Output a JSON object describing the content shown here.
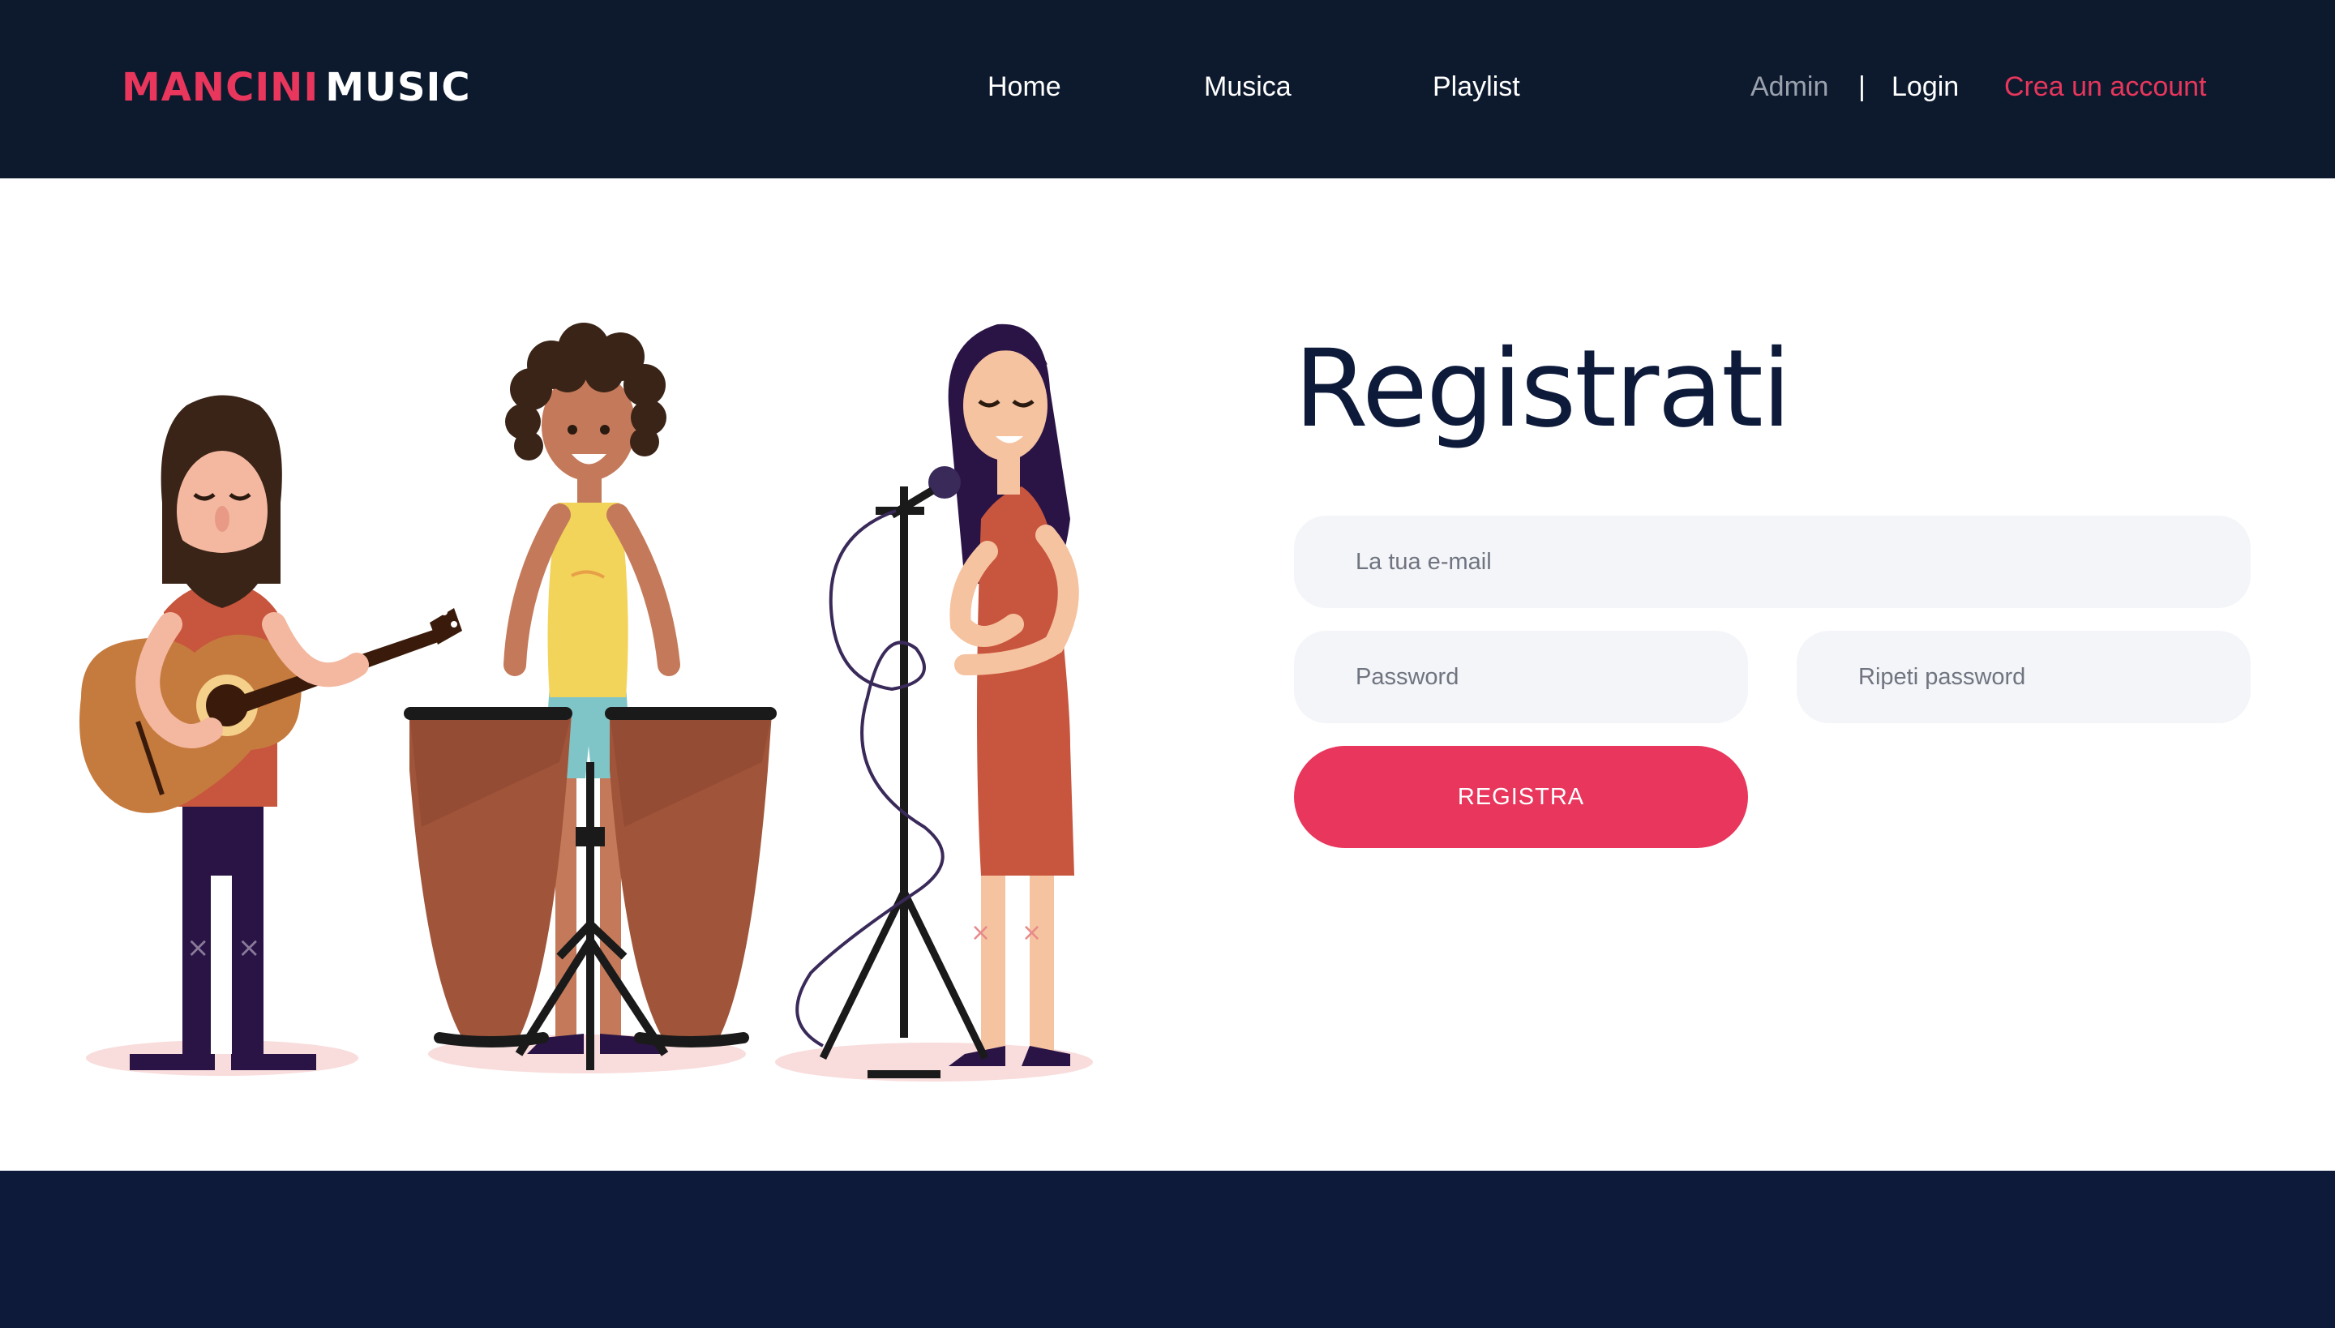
{
  "header": {
    "brand_part1": "MANCINI",
    "brand_part2": "MUSIC",
    "nav": {
      "home": "Home",
      "musica": "Musica",
      "playlist": "Playlist"
    },
    "account": {
      "admin": "Admin",
      "separator": "|",
      "login": "Login",
      "create": "Crea un account"
    }
  },
  "form": {
    "title": "Registrati",
    "email_placeholder": "La tua e-mail",
    "password_placeholder": "Password",
    "repeat_placeholder": "Ripeti password",
    "submit_label": "REGISTRA"
  },
  "colors": {
    "header_bg": "#0d1a2e",
    "accent": "#e8365c",
    "title": "#0d1a3a",
    "field_bg": "#f4f5f8",
    "footer_bg": "#0d1a3a"
  },
  "icons": {
    "illustration": "band-illustration"
  }
}
